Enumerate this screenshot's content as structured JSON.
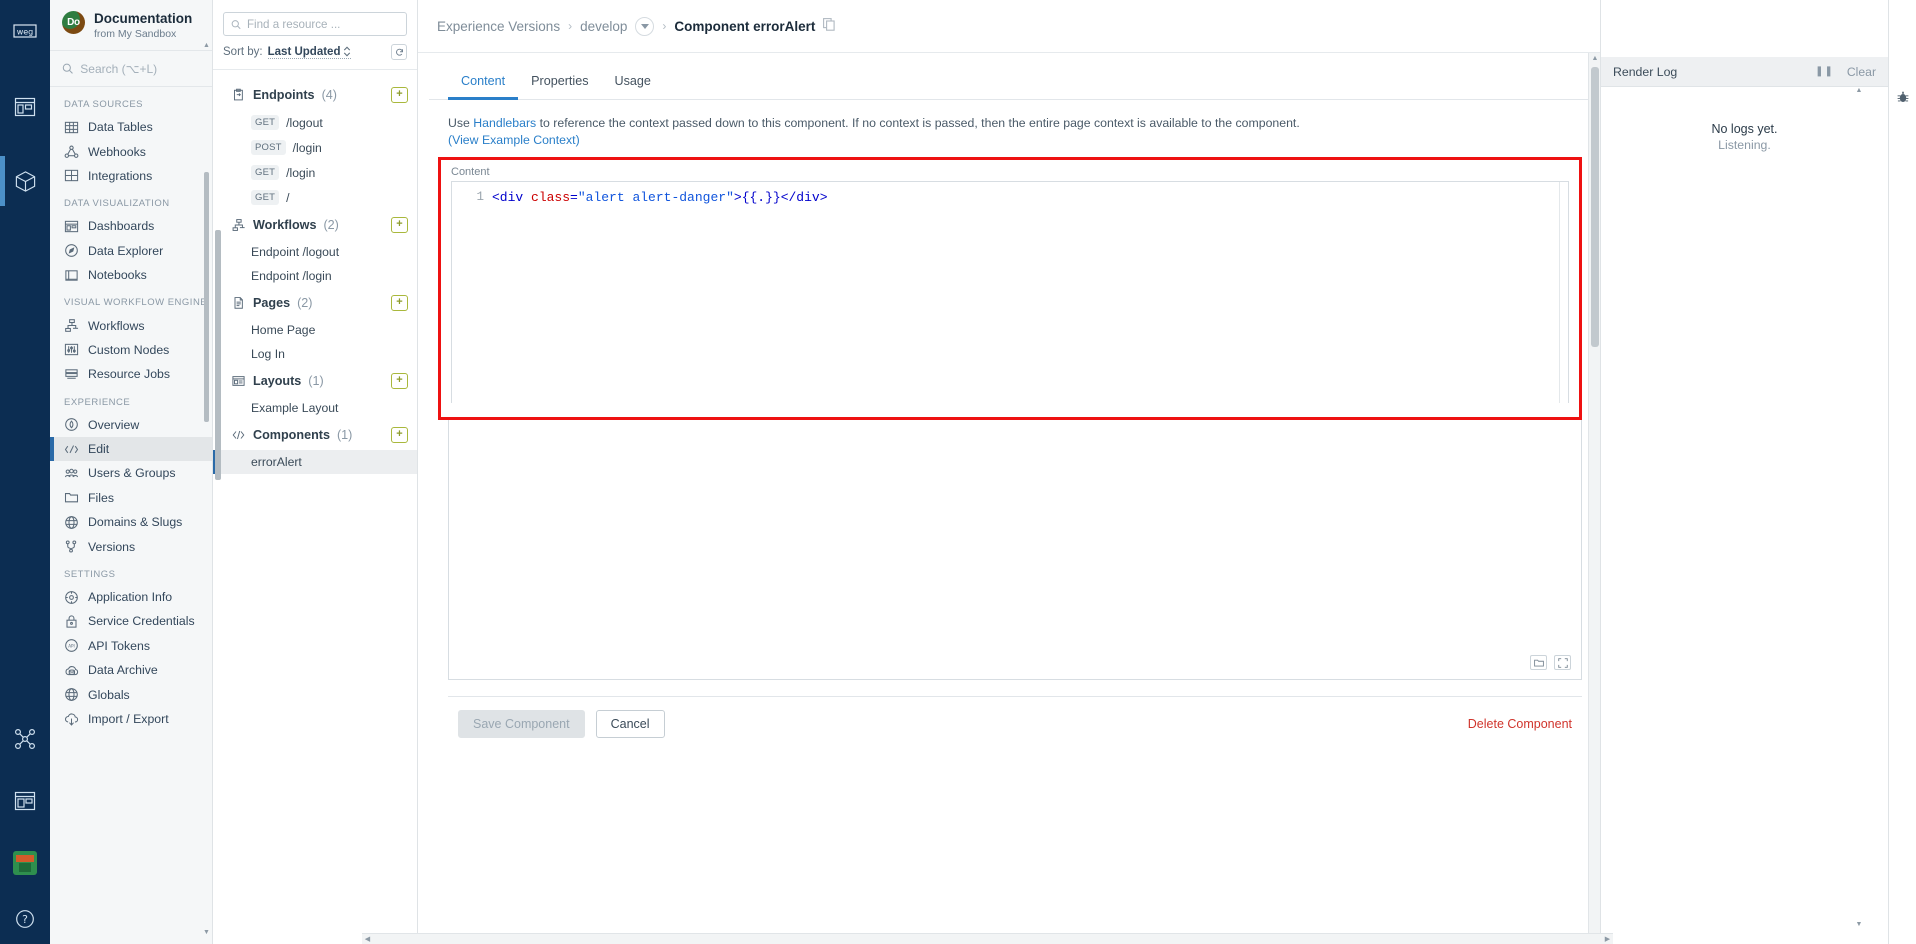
{
  "rail": {
    "items": [
      {
        "name": "weg-logo-icon",
        "label": "WEG"
      },
      {
        "name": "application-icon",
        "label": "Application"
      },
      {
        "name": "package-icon",
        "label": "Package",
        "active": true
      },
      {
        "name": "workflow-nodes-icon",
        "label": "Nodes"
      },
      {
        "name": "dashboard-icon",
        "label": "Dashboard"
      }
    ],
    "avatar_label": "User",
    "help_label": "?"
  },
  "sidebar": {
    "app_name": "Documentation",
    "app_sub": "from My Sandbox",
    "app_logo_text": "Do",
    "search_placeholder": "Search (⌥+L)",
    "groups": [
      {
        "label": "DATA SOURCES",
        "items": [
          {
            "label": "Data Tables",
            "icon": "table-icon"
          },
          {
            "label": "Webhooks",
            "icon": "webhook-icon"
          },
          {
            "label": "Integrations",
            "icon": "integrations-icon"
          }
        ]
      },
      {
        "label": "DATA VISUALIZATION",
        "items": [
          {
            "label": "Dashboards",
            "icon": "dashboard-icon"
          },
          {
            "label": "Data Explorer",
            "icon": "compass-icon"
          },
          {
            "label": "Notebooks",
            "icon": "notebook-icon"
          }
        ]
      },
      {
        "label": "VISUAL WORKFLOW ENGINE",
        "items": [
          {
            "label": "Workflows",
            "icon": "workflow-icon"
          },
          {
            "label": "Custom Nodes",
            "icon": "sliders-icon"
          },
          {
            "label": "Resource Jobs",
            "icon": "server-icon"
          }
        ]
      },
      {
        "label": "EXPERIENCE",
        "items": [
          {
            "label": "Overview",
            "icon": "overview-icon"
          },
          {
            "label": "Edit",
            "icon": "code-pencil-icon",
            "active": true
          },
          {
            "label": "Users & Groups",
            "icon": "users-icon"
          },
          {
            "label": "Files",
            "icon": "folder-icon"
          },
          {
            "label": "Domains & Slugs",
            "icon": "globe-icon"
          },
          {
            "label": "Versions",
            "icon": "branch-icon"
          }
        ]
      },
      {
        "label": "SETTINGS",
        "items": [
          {
            "label": "Application Info",
            "icon": "gear-icon"
          },
          {
            "label": "Service Credentials",
            "icon": "lock-icon"
          },
          {
            "label": "API Tokens",
            "icon": "api-token-icon"
          },
          {
            "label": "Data Archive",
            "icon": "archive-cloud-icon"
          },
          {
            "label": "Globals",
            "icon": "globe-icon"
          },
          {
            "label": "Import / Export",
            "icon": "import-export-icon"
          }
        ]
      }
    ]
  },
  "resources": {
    "search_placeholder": "Find a resource ...",
    "sort_label": "Sort by:",
    "sort_value": "Last Updated",
    "refresh_icon": "refresh-icon",
    "add_label": "+",
    "sections": [
      {
        "title": "Endpoints",
        "count": "(4)",
        "icon": "endpoint-icon",
        "items": [
          {
            "verb": "GET",
            "label": "/logout"
          },
          {
            "verb": "POST",
            "label": "/login"
          },
          {
            "verb": "GET",
            "label": "/login"
          },
          {
            "verb": "GET",
            "label": "/"
          }
        ]
      },
      {
        "title": "Workflows",
        "count": "(2)",
        "icon": "workflow-icon",
        "items": [
          {
            "verb": "",
            "label": "Endpoint /logout"
          },
          {
            "verb": "",
            "label": "Endpoint /login"
          }
        ]
      },
      {
        "title": "Pages",
        "count": "(2)",
        "icon": "page-icon",
        "items": [
          {
            "verb": "",
            "label": "Home Page"
          },
          {
            "verb": "",
            "label": "Log In"
          }
        ]
      },
      {
        "title": "Layouts",
        "count": "(1)",
        "icon": "layout-icon",
        "items": [
          {
            "verb": "",
            "label": "Example Layout"
          }
        ]
      },
      {
        "title": "Components",
        "count": "(1)",
        "icon": "component-icon",
        "items": [
          {
            "verb": "",
            "label": "errorAlert",
            "selected": true
          }
        ]
      }
    ]
  },
  "breadcrumb": {
    "root": "Experience Versions",
    "sep": "›",
    "version": "develop",
    "current": "Component errorAlert",
    "copy_icon": "copy-icon"
  },
  "tabs": [
    {
      "label": "Content",
      "active": true
    },
    {
      "label": "Properties",
      "active": false
    },
    {
      "label": "Usage",
      "active": false
    }
  ],
  "hint": {
    "before": "Use ",
    "link": "Handlebars",
    "after": " to reference the context passed down to this component. If no context is passed, then the entire page context is available to the component.",
    "example_link": "(View Example Context)"
  },
  "editor": {
    "label": "Content",
    "line_number": "1",
    "code": {
      "open_tag": "<div ",
      "attr_name": "class",
      "equals": "=",
      "attr_value": "\"alert alert-danger\"",
      "gt": ">",
      "mustache": "{{.}}",
      "close_tag": "</div>"
    },
    "tools": [
      {
        "icon": "open-folder-icon",
        "glyph": "☐"
      },
      {
        "icon": "fullscreen-icon",
        "glyph": "⛶"
      }
    ]
  },
  "footer": {
    "save_label": "Save Component",
    "cancel_label": "Cancel",
    "delete_label": "Delete Component"
  },
  "render_log": {
    "title": "Render Log",
    "pause_icon": "pause-icon",
    "clear_label": "Clear",
    "empty_title": "No logs yet.",
    "empty_sub": "Listening.",
    "debug_icon": "bug-icon"
  },
  "colors": {
    "rail_bg": "#0c2d52",
    "accent_blue": "#2a7fc9",
    "active_marker": "#2a6aa8",
    "danger_red": "#d0342c",
    "highlight_border": "#ee1111",
    "add_green": "#a9b83c"
  }
}
